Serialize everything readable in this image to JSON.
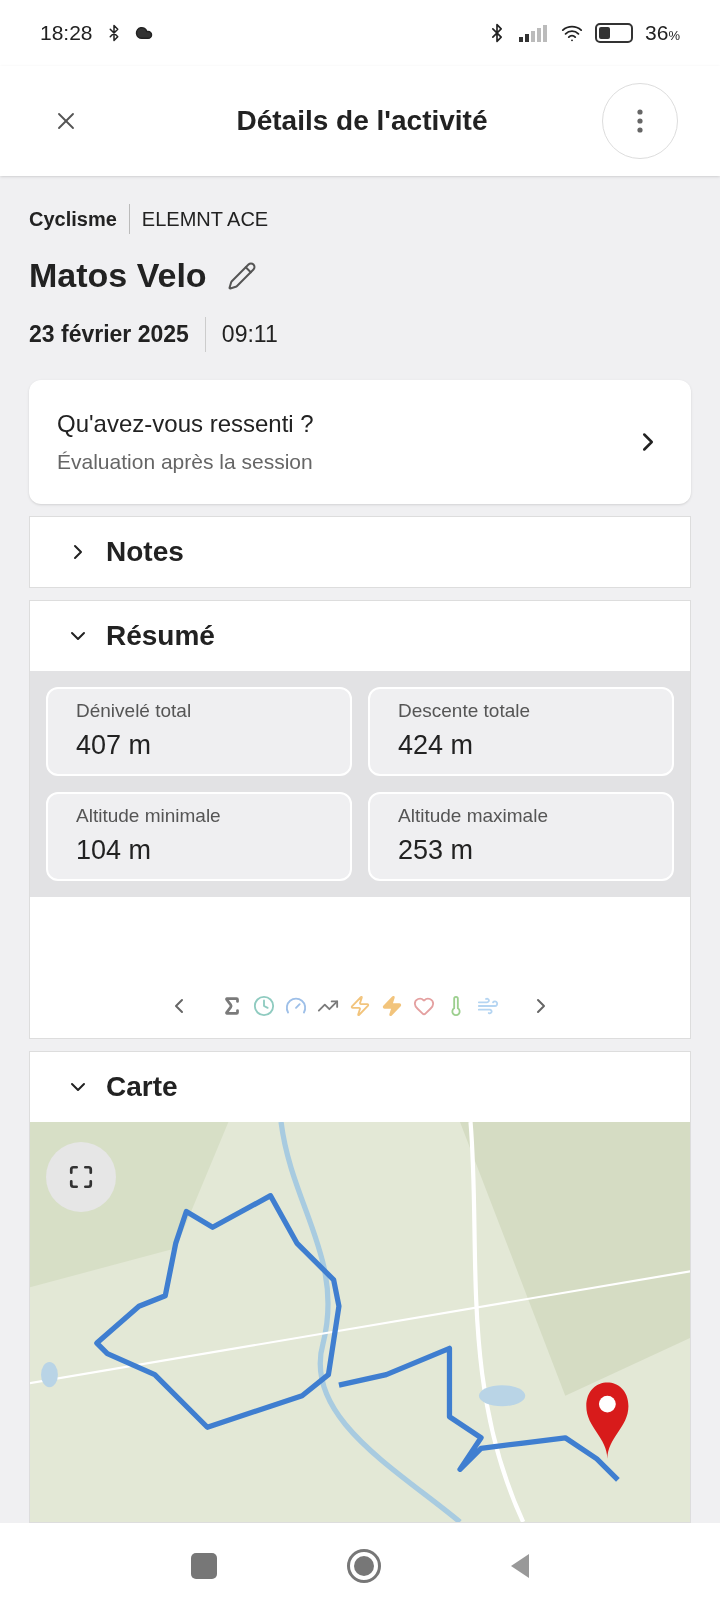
{
  "status_bar": {
    "time": "18:28",
    "battery": "36",
    "battery_unit": "%"
  },
  "header": {
    "title": "Détails de l'activité"
  },
  "activity": {
    "sport": "Cyclisme",
    "device": "ELEMNT ACE",
    "name": "Matos Velo",
    "date": "23 février 2025",
    "time": "09:11"
  },
  "feeling": {
    "title": "Qu'avez-vous ressenti ?",
    "subtitle": "Évaluation après la session"
  },
  "sections": [
    {
      "kind": "notes",
      "title": "Notes",
      "expanded": false
    },
    {
      "kind": "summary",
      "title": "Résumé",
      "expanded": true,
      "stats": [
        {
          "label": "Dénivelé total",
          "value": "407 m"
        },
        {
          "label": "Descente totale",
          "value": "424 m"
        },
        {
          "label": "Altitude minimale",
          "value": "104 m"
        },
        {
          "label": "Altitude maximale",
          "value": "253 m"
        }
      ],
      "metric_tabs": [
        {
          "kind": "sum",
          "color": "#7a7a7a"
        },
        {
          "kind": "clock",
          "color": "#8fcbc0"
        },
        {
          "kind": "gauge",
          "color": "#9dbfe8"
        },
        {
          "kind": "trend",
          "color": "#7a7a7a"
        },
        {
          "kind": "bolt",
          "color": "#f2c47c"
        },
        {
          "kind": "bolt-filled",
          "color": "#f2c47c"
        },
        {
          "kind": "heart",
          "color": "#e4a0a0"
        },
        {
          "kind": "thermometer",
          "color": "#9ccf8e"
        },
        {
          "kind": "wind",
          "color": "#b5d5f2"
        }
      ]
    },
    {
      "kind": "map",
      "title": "Carte",
      "expanded": true
    }
  ]
}
